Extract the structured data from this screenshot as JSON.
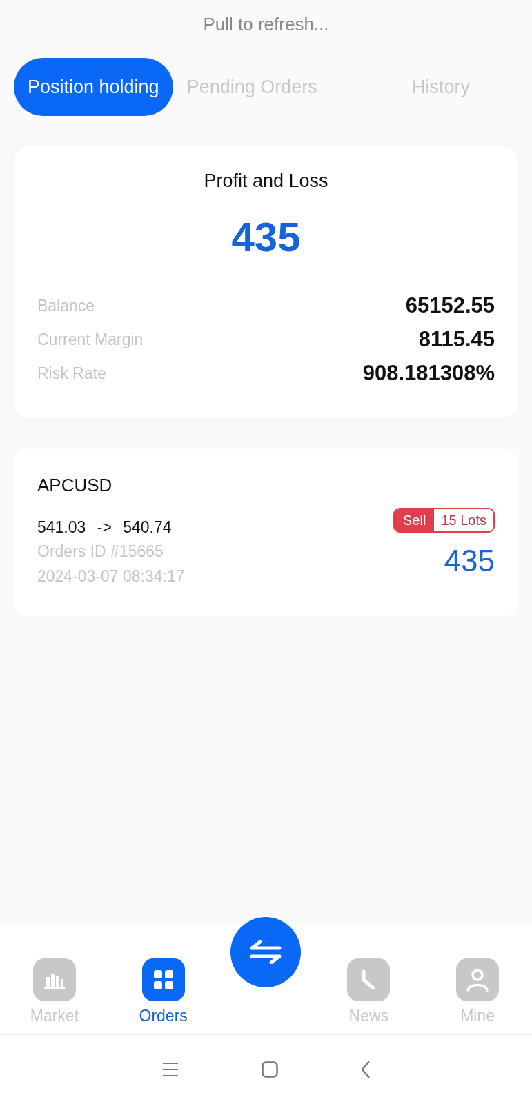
{
  "refresh_hint": "Pull to refresh...",
  "tabs": [
    {
      "label": "Position holding",
      "selected": true
    },
    {
      "label": "Pending Orders",
      "selected": false
    },
    {
      "label": "History",
      "selected": false
    }
  ],
  "summary": {
    "title": "Profit and Loss",
    "pnl": "435",
    "rows": [
      {
        "label": "Balance",
        "value": "65152.55"
      },
      {
        "label": "Current Margin",
        "value": "8115.45"
      },
      {
        "label": "Risk Rate",
        "value": "908.181308%"
      }
    ]
  },
  "orders": [
    {
      "symbol": "APCUSD",
      "open_price": "541.03",
      "arrow": "->",
      "current_price": "540.74",
      "order_id": "Orders ID #15665",
      "time": "2024-03-07 08:34:17",
      "side": "Sell",
      "lots": "15 Lots",
      "pnl": "435"
    }
  ],
  "bottom_nav": [
    {
      "kind": "market",
      "label": "Market",
      "selected": false
    },
    {
      "kind": "orders",
      "label": "Orders",
      "selected": true
    },
    {
      "kind": "trade"
    },
    {
      "kind": "news",
      "label": "News",
      "selected": false
    },
    {
      "kind": "mine",
      "label": "Mine",
      "selected": false
    }
  ]
}
